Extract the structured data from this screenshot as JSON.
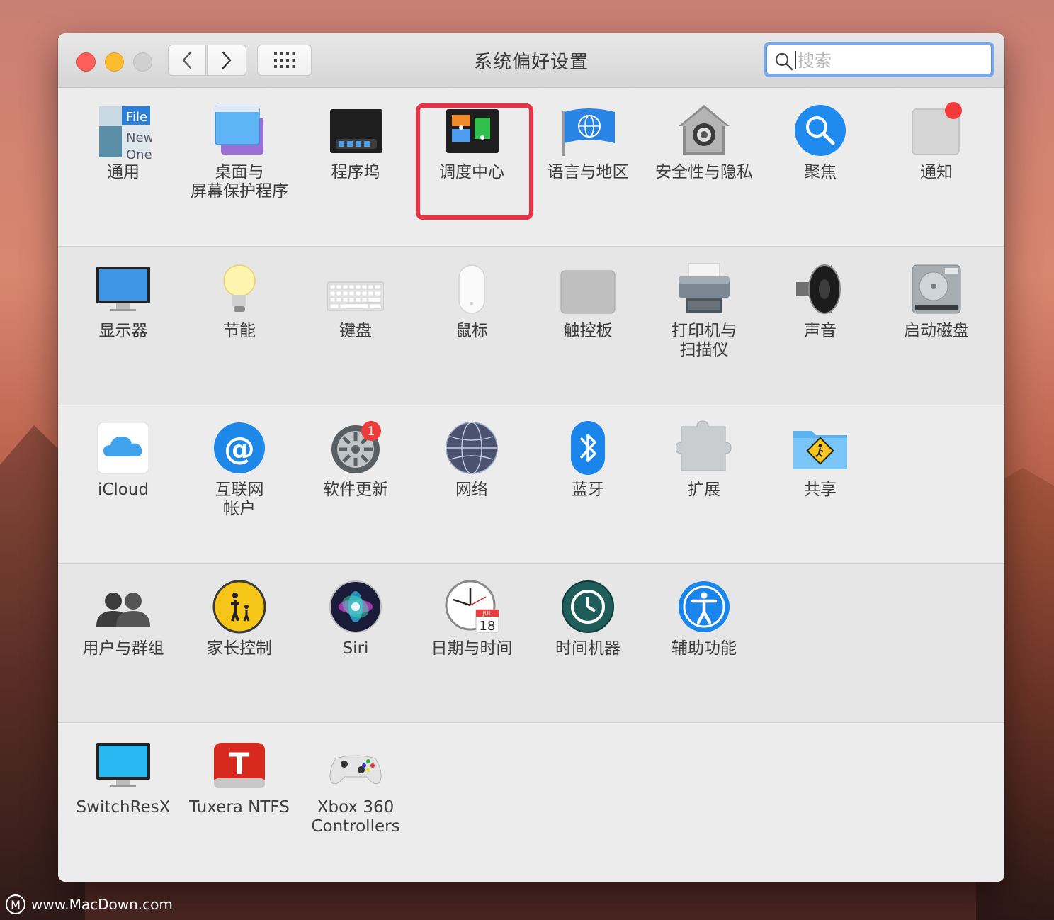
{
  "window": {
    "title": "系统偏好设置",
    "search_placeholder": "搜索"
  },
  "sections": [
    [
      {
        "label": "通用",
        "icon": "general-icon"
      },
      {
        "label": "桌面与\n屏幕保护程序",
        "icon": "desktop-screensaver-icon"
      },
      {
        "label": "程序坞",
        "icon": "dock-icon"
      },
      {
        "label": "调度中心",
        "icon": "mission-control-icon"
      },
      {
        "label": "语言与地区",
        "icon": "language-region-icon"
      },
      {
        "label": "安全性与隐私",
        "icon": "security-privacy-icon"
      },
      {
        "label": "聚焦",
        "icon": "spotlight-icon"
      },
      {
        "label": "通知",
        "icon": "notifications-icon"
      }
    ],
    [
      {
        "label": "显示器",
        "icon": "displays-icon"
      },
      {
        "label": "节能",
        "icon": "energy-saver-icon"
      },
      {
        "label": "键盘",
        "icon": "keyboard-icon"
      },
      {
        "label": "鼠标",
        "icon": "mouse-icon"
      },
      {
        "label": "触控板",
        "icon": "trackpad-icon"
      },
      {
        "label": "打印机与\n扫描仪",
        "icon": "printers-scanners-icon"
      },
      {
        "label": "声音",
        "icon": "sound-icon"
      },
      {
        "label": "启动磁盘",
        "icon": "startup-disk-icon"
      }
    ],
    [
      {
        "label": "iCloud",
        "icon": "icloud-icon"
      },
      {
        "label": "互联网\n帐户",
        "icon": "internet-accounts-icon"
      },
      {
        "label": "软件更新",
        "icon": "software-update-icon",
        "badge": "1"
      },
      {
        "label": "网络",
        "icon": "network-icon"
      },
      {
        "label": "蓝牙",
        "icon": "bluetooth-icon"
      },
      {
        "label": "扩展",
        "icon": "extensions-icon"
      },
      {
        "label": "共享",
        "icon": "sharing-icon"
      }
    ],
    [
      {
        "label": "用户与群组",
        "icon": "users-groups-icon"
      },
      {
        "label": "家长控制",
        "icon": "parental-controls-icon"
      },
      {
        "label": "Siri",
        "icon": "siri-icon"
      },
      {
        "label": "日期与时间",
        "icon": "date-time-icon",
        "cal_month": "JUL",
        "cal_day": "18"
      },
      {
        "label": "时间机器",
        "icon": "time-machine-icon"
      },
      {
        "label": "辅助功能",
        "icon": "accessibility-icon"
      }
    ],
    [
      {
        "label": "SwitchResX",
        "icon": "switchresx-icon"
      },
      {
        "label": "Tuxera NTFS",
        "icon": "tuxera-ntfs-icon"
      },
      {
        "label": "Xbox 360\nControllers",
        "icon": "xbox-controllers-icon"
      }
    ]
  ],
  "general_icon_text": {
    "line1": "File",
    "line2": "New",
    "line3": "One"
  },
  "watermark": {
    "logo": "M",
    "text": "www.MacDown.com"
  }
}
